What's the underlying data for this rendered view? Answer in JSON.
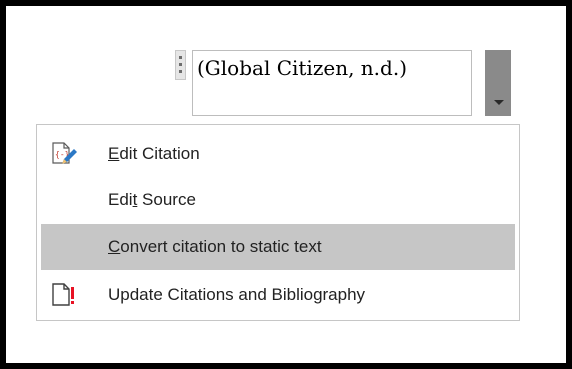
{
  "citation": {
    "text": "(Global Citizen, n.d.)"
  },
  "menu": {
    "items": [
      {
        "before": "",
        "accel": "E",
        "after": "dit Citation",
        "icon": "edit-citation-icon"
      },
      {
        "before": "Edi",
        "accel": "t",
        "after": " Source",
        "icon": ""
      },
      {
        "before": "",
        "accel": "C",
        "after": "onvert citation to static text",
        "icon": "",
        "highlighted": true
      },
      {
        "before": "Update Citations and Bibliography",
        "accel": "",
        "after": "",
        "icon": "update-citations-icon"
      }
    ]
  },
  "colors": {
    "highlight": "#c6c6c6",
    "frame": "#000000",
    "update_icon_accent": "#e81123"
  }
}
